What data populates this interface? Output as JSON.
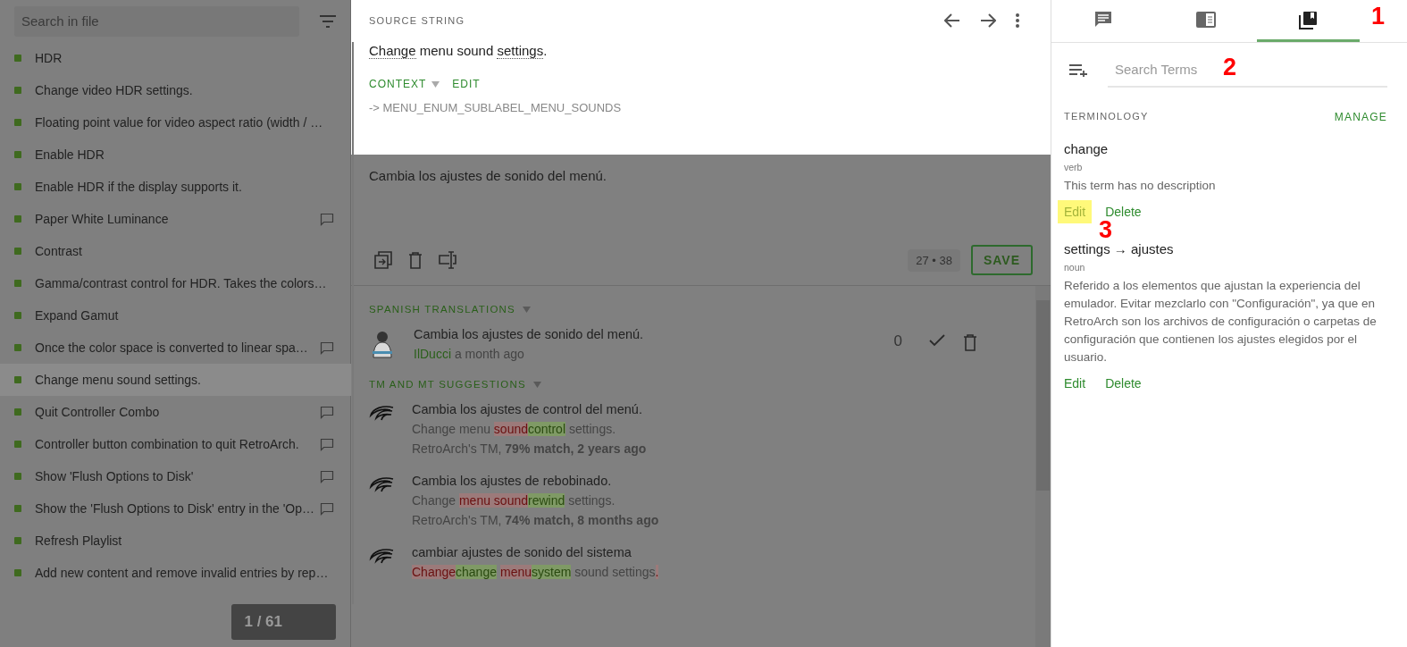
{
  "file_list": {
    "search": {
      "placeholder": "Search in file"
    },
    "items": [
      {
        "text": "HDR",
        "comment": false,
        "selected": false
      },
      {
        "text": "Change video HDR settings.",
        "comment": false,
        "selected": false
      },
      {
        "text": "Floating point value for video aspect ratio (width / …",
        "comment": false,
        "selected": false
      },
      {
        "text": "Enable HDR",
        "comment": false,
        "selected": false
      },
      {
        "text": "Enable HDR if the display supports it.",
        "comment": false,
        "selected": false
      },
      {
        "text": "Paper White Luminance",
        "comment": true,
        "selected": false
      },
      {
        "text": "Contrast",
        "comment": false,
        "selected": false
      },
      {
        "text": "Gamma/contrast control for HDR. Takes the colors…",
        "comment": false,
        "selected": false
      },
      {
        "text": "Expand Gamut",
        "comment": false,
        "selected": false
      },
      {
        "text": "Once the color space is converted to linear spa…",
        "comment": true,
        "selected": false
      },
      {
        "text": "Change menu sound settings.",
        "comment": false,
        "selected": true
      },
      {
        "text": "Quit Controller Combo",
        "comment": true,
        "selected": false
      },
      {
        "text": "Controller button combination to quit RetroArch.",
        "comment": true,
        "selected": false
      },
      {
        "text": "Show 'Flush Options to Disk'",
        "comment": true,
        "selected": false
      },
      {
        "text": "Show the 'Flush Options to Disk' entry in the 'Op…",
        "comment": true,
        "selected": false
      },
      {
        "text": "Refresh Playlist",
        "comment": false,
        "selected": false
      },
      {
        "text": "Add new content and remove invalid entries by rep…",
        "comment": false,
        "selected": false
      }
    ],
    "pager": "1 / 61"
  },
  "source": {
    "heading": "SOURCE STRING",
    "segments": [
      {
        "text": "Change",
        "term": true
      },
      {
        "text": " menu sound ",
        "term": false
      },
      {
        "text": "settings",
        "term": true
      },
      {
        "text": ".",
        "term": false
      }
    ],
    "context_label": "CONTEXT",
    "edit_label": "EDIT",
    "key": "-> MENU_ENUM_SUBLABEL_MENU_SOUNDS"
  },
  "editor": {
    "value": "Cambia los ajustes de sonido del menú.",
    "counter": "27 • 38",
    "save": "SAVE"
  },
  "translations": {
    "heading": "SPANISH TRANSLATIONS",
    "items": [
      {
        "text": "Cambia los ajustes de sonido del menú.",
        "author": "IlDucci",
        "time": "a month ago",
        "votes": "0"
      }
    ]
  },
  "suggestions": {
    "heading": "TM AND MT SUGGESTIONS",
    "items": [
      {
        "text": "Cambia los ajustes de control del menú.",
        "diff": [
          {
            "text": "Change menu ",
            "kind": "same"
          },
          {
            "text": "sound",
            "kind": "del"
          },
          {
            "text": "control",
            "kind": "ins"
          },
          {
            "text": " settings.",
            "kind": "same"
          }
        ],
        "meta": "RetroArch's TM, **79% match, 2 years ago**"
      },
      {
        "text": "Cambia los ajustes de rebobinado.",
        "diff": [
          {
            "text": "Change ",
            "kind": "same"
          },
          {
            "text": "menu sound",
            "kind": "del"
          },
          {
            "text": "rewind",
            "kind": "ins"
          },
          {
            "text": " settings.",
            "kind": "same"
          }
        ],
        "meta": "RetroArch's TM, **74% match, 8 months ago**"
      },
      {
        "text": "cambiar ajustes de sonido del sistema",
        "diff": [
          {
            "text": "Change",
            "kind": "del"
          },
          {
            "text": "change",
            "kind": "ins",
            "gap": true
          },
          {
            "text": "menu",
            "kind": "del"
          },
          {
            "text": "system",
            "kind": "ins"
          },
          {
            "text": " sound settings",
            "kind": "same"
          },
          {
            "text": ".",
            "kind": "del"
          }
        ]
      }
    ]
  },
  "side_tabs": [
    {
      "kind": "comments",
      "selected": false
    },
    {
      "kind": "reference",
      "selected": false
    },
    {
      "kind": "glossary",
      "selected": true
    }
  ],
  "terms_search": {
    "placeholder": "Search Terms"
  },
  "terminology": {
    "heading": "TERMINOLOGY",
    "manage": "MANAGE",
    "terms": [
      {
        "term": "change",
        "pos": "verb",
        "description": "This term has no description",
        "edit": "Edit",
        "delete": "Delete",
        "edit_highlighted": true
      },
      {
        "term": "settings → ajustes",
        "pos": "noun",
        "description": "Referido a los elementos que ajustan la experiencia del emulador. Evitar mezclarlo con \"Configuración\", ya que en RetroArch son los archivos de configuración o carpetas de configuración que contienen los ajustes elegidos por el usuario.",
        "edit": "Edit",
        "delete": "Delete",
        "edit_highlighted": false
      }
    ]
  },
  "annotations": [
    {
      "label": "1"
    },
    {
      "label": "2"
    },
    {
      "label": "3"
    }
  ]
}
